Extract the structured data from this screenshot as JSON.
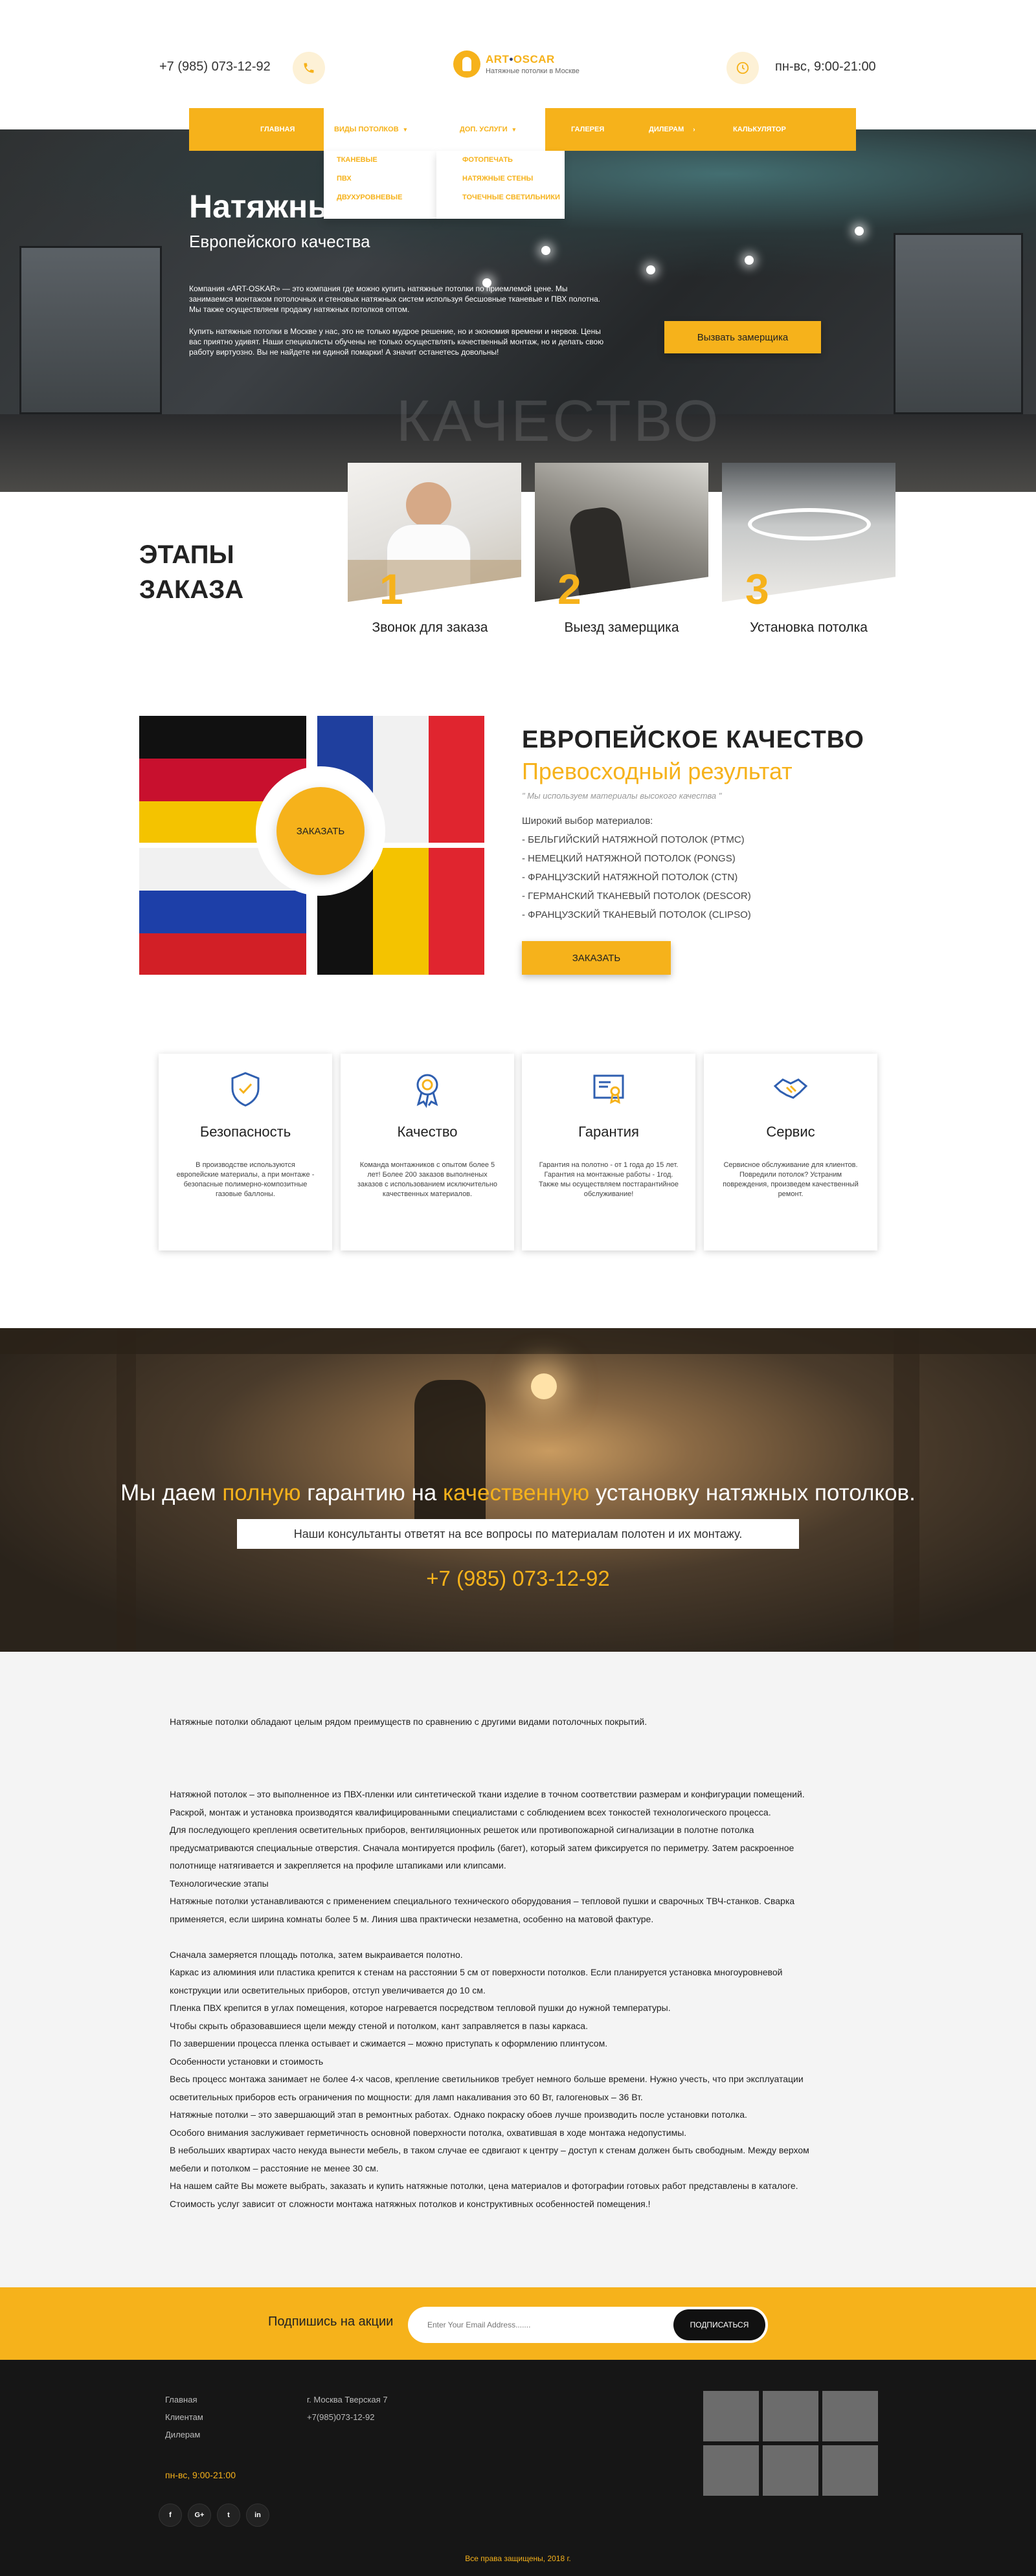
{
  "header": {
    "phone": "+7 (985) 073-12-92",
    "logo_title_a": "ART",
    "logo_title_dot": "•",
    "logo_title_b": "OSCAR",
    "logo_subtitle": "Натяжные потолки в Москве",
    "hours": "пн-вс, 9:00-21:00"
  },
  "nav": {
    "items": [
      {
        "label": "Главная"
      },
      {
        "label": "Виды потолков"
      },
      {
        "label": "Доп. услуги"
      },
      {
        "label": "Галерея"
      },
      {
        "label": "Дилерам"
      },
      {
        "label": "Калькулятор"
      }
    ],
    "dropdown_ceilings": [
      "Тканевые",
      "ПВХ",
      "Двухуровневые"
    ],
    "dropdown_services": [
      "Фотопечать",
      "Натяжные стены",
      "Точечные светильники"
    ]
  },
  "hero": {
    "title": "Натяжные потолки",
    "subtitle": "Европейского качества",
    "para1": "Компания «ART-OSKAR» — это компания где можно купить натяжные потолки по приемлемой цене. Мы занимаемся монтажом потолочных и стеновых натяжных систем используя бесшовные тканевые и ПВХ полотна. Мы также осуществляем продажу натяжных потолков оптом.",
    "para2": "Купить натяжные потолки в Москве у нас, это не только мудрое решение, но и экономия времени и нервов. Цены вас приятно удивят. Наши специалисты обучены не только осуществлять качественный монтаж, но и делать свою работу виртуозно. Вы не найдете ни единой помарки! А значит останетесь довольны!",
    "cta": "Вызвать замерщика",
    "watermark": "КАЧЕСТВО"
  },
  "stages": {
    "title_line1": "ЭТАПЫ",
    "title_line2": "ЗАКАЗА",
    "items": [
      {
        "num": "1",
        "label": "Звонок для заказа"
      },
      {
        "num": "2",
        "label": "Выезд замерщика"
      },
      {
        "num": "3",
        "label": "Установка потолка"
      }
    ]
  },
  "european": {
    "title": "ЕВРОПЕЙСКОЕ КАЧЕСТВО",
    "subtitle": "Превосходный результат",
    "quote": "\" Мы используем материалы высокого качества \"",
    "list_heading": "Широкий выбор материалов:",
    "list": [
      "- БЕЛЬГИЙСКИЙ НАТЯЖНОЙ ПОТОЛОК (PTMC)",
      "- НЕМЕЦКИЙ НАТЯЖНОЙ ПОТОЛОК (PONGS)",
      "- ФРАНЦУЗСКИЙ НАТЯЖНОЙ ПОТОЛОК (CTN)",
      "- ГЕРМАНСКИЙ ТКАНЕВЫЙ ПОТОЛОК (DESCOR)",
      "- ФРАНЦУЗСКИЙ ТКАНЕВЫЙ ПОТОЛОК (CLIPSO)"
    ],
    "order_circle": "ЗАКАЗАТЬ",
    "order_button": "ЗАКАЗАТЬ"
  },
  "features": [
    {
      "title": "Безопасность",
      "text": "В производстве используются европейские материалы, а при монтаже - безопасные полимерно-композитные газовые баллоны."
    },
    {
      "title": "Качество",
      "text": "Команда монтажников с опытом более 5 лет! Более 200 заказов выполненых заказов с использованием исключительно качественных материалов."
    },
    {
      "title": "Гарантия",
      "text": "Гарантия на полотно - от 1 года до 15 лет. Гарантия на монтажные работы - 1год. Также мы осуществляем постгарантийное обслуживание!"
    },
    {
      "title": "Сервис",
      "text": "Сервисное обслуживание для клиентов. Повредили потолок? Устраним повреждения, произведем качественный ремонт."
    }
  ],
  "guarantee": {
    "t1": "Мы даем ",
    "t2": "полную",
    "t3": " гарантию на ",
    "t4": "качественную",
    "t5": " установку натяжных потолков.",
    "box": "Наши консультанты ответят на все вопросы по материалам полотен и их монтажу.",
    "phone": "+7 (985) 073-12-92"
  },
  "article": {
    "intro": "Натяжные потолки обладают целым рядом преимуществ по сравнению с другими видами потолочных покрытий.",
    "lines": [
      "Натяжной потолок – это выполненное из ПВХ-пленки или синтетической ткани изделие в точном соответствии размерам и конфигурации помещений.",
      "Раскрой, монтаж и установка производятся квалифицированными специалистами с соблюдением всех тонкостей технологического процесса.",
      "Для последующего крепления осветительных приборов, вентиляционных решеток или противопожарной сигнализации в полотне потолка",
      "предусматриваются специальные отверстия. Сначала монтируется профиль (багет), который затем фиксируется по периметру. Затем раскроенное",
      "полотнище натягивается и закрепляется на профиле штапиками или клипсами.",
      "Технологические этапы",
      "Натяжные потолки устанавливаются с применением специального технического оборудования – тепловой пушки и сварочных ТВЧ-станков. Сварка",
      "применяется, если ширина комнаты более 5 м. Линия шва практически незаметна, особенно на матовой фактуре.",
      "",
      "Сначала замеряется площадь потолка, затем выкраивается полотно.",
      "Каркас из алюминия или пластика крепится к стенам на расстоянии 5 см от поверхности потолков. Если планируется установка многоуровневой",
      "конструкции или осветительных приборов, отступ увеличивается до 10 см.",
      "Пленка ПВХ крепится в углах помещения, которое нагревается посредством тепловой пушки до нужной температуры.",
      "Чтобы скрыть образовавшиеся щели между стеной и потолком, кант заправляется в пазы каркаса.",
      "По завершении процесса пленка остывает и сжимается – можно приступать к оформлению плинтусом.",
      "Особенности установки и стоимость",
      "Весь процесс монтажа занимает не более 4-х часов, крепление светильников требует немного больше времени. Нужно учесть, что при эксплуатации",
      "осветительных приборов есть ограничения по мощности: для ламп накаливания это 60 Вт, галогеновых – 36 Вт.",
      "Натяжные потолки – это завершающий этап в ремонтных работах. Однако покраску обоев лучше производить после установки потолка.",
      "Особого внимания заслуживает герметичность основной поверхности потолка, охватившая в ходе монтажа недопустимы.",
      "В небольших квартирах часто некуда вынести мебель, в таком случае ее сдвигают к центру – доступ к стенам должен быть свободным. Между верхом",
      "мебели и потолком – расстояние не менее 30 см.",
      "На нашем сайте Вы можете выбрать, заказать и купить натяжные потолки, цена материалов и фотографии готовых работ представлены в каталоге.",
      "Стоимость услуг зависит от сложности монтажа натяжных потолков и конструктивных особенностей помещения.!"
    ]
  },
  "subscribe": {
    "label": "Подпишись на акции",
    "placeholder": "Enter Your Email Address.......",
    "button": "ПОДПИСАТЬСЯ"
  },
  "footer": {
    "links": [
      "Главная",
      "Клиентам",
      "Дилерам"
    ],
    "address": "г. Москва Тверская 7",
    "phone": "+7(985)073-12-92",
    "hours": "пн-вс, 9:00-21:00",
    "social": [
      "f",
      "G+",
      "t",
      "in"
    ],
    "copyright": "Все права защищены, 2018 г."
  },
  "colors": {
    "accent": "#f6b21b",
    "dark": "#161616",
    "light_bg": "#f4f4f4"
  }
}
